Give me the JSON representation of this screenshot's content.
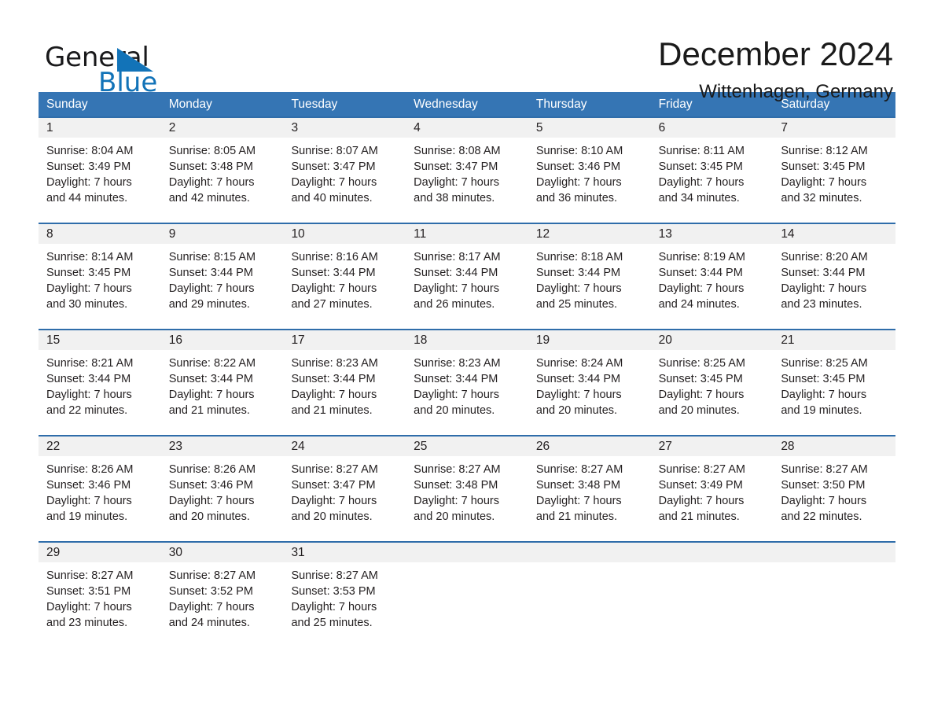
{
  "brand": {
    "name_part1": "General",
    "name_part2": "Blue",
    "accent_color": "#1273b8"
  },
  "header": {
    "title": "December 2024",
    "subtitle": "Wittenhagen, Germany"
  },
  "colors": {
    "header_bar": "#3575b4",
    "row_divider": "#2f6daa",
    "day_band": "#f1f1f1"
  },
  "calendar": {
    "weekdays": [
      "Sunday",
      "Monday",
      "Tuesday",
      "Wednesday",
      "Thursday",
      "Friday",
      "Saturday"
    ],
    "weeks": [
      [
        {
          "day": "1",
          "sunrise": "Sunrise: 8:04 AM",
          "sunset": "Sunset: 3:49 PM",
          "daylight1": "Daylight: 7 hours",
          "daylight2": "and 44 minutes."
        },
        {
          "day": "2",
          "sunrise": "Sunrise: 8:05 AM",
          "sunset": "Sunset: 3:48 PM",
          "daylight1": "Daylight: 7 hours",
          "daylight2": "and 42 minutes."
        },
        {
          "day": "3",
          "sunrise": "Sunrise: 8:07 AM",
          "sunset": "Sunset: 3:47 PM",
          "daylight1": "Daylight: 7 hours",
          "daylight2": "and 40 minutes."
        },
        {
          "day": "4",
          "sunrise": "Sunrise: 8:08 AM",
          "sunset": "Sunset: 3:47 PM",
          "daylight1": "Daylight: 7 hours",
          "daylight2": "and 38 minutes."
        },
        {
          "day": "5",
          "sunrise": "Sunrise: 8:10 AM",
          "sunset": "Sunset: 3:46 PM",
          "daylight1": "Daylight: 7 hours",
          "daylight2": "and 36 minutes."
        },
        {
          "day": "6",
          "sunrise": "Sunrise: 8:11 AM",
          "sunset": "Sunset: 3:45 PM",
          "daylight1": "Daylight: 7 hours",
          "daylight2": "and 34 minutes."
        },
        {
          "day": "7",
          "sunrise": "Sunrise: 8:12 AM",
          "sunset": "Sunset: 3:45 PM",
          "daylight1": "Daylight: 7 hours",
          "daylight2": "and 32 minutes."
        }
      ],
      [
        {
          "day": "8",
          "sunrise": "Sunrise: 8:14 AM",
          "sunset": "Sunset: 3:45 PM",
          "daylight1": "Daylight: 7 hours",
          "daylight2": "and 30 minutes."
        },
        {
          "day": "9",
          "sunrise": "Sunrise: 8:15 AM",
          "sunset": "Sunset: 3:44 PM",
          "daylight1": "Daylight: 7 hours",
          "daylight2": "and 29 minutes."
        },
        {
          "day": "10",
          "sunrise": "Sunrise: 8:16 AM",
          "sunset": "Sunset: 3:44 PM",
          "daylight1": "Daylight: 7 hours",
          "daylight2": "and 27 minutes."
        },
        {
          "day": "11",
          "sunrise": "Sunrise: 8:17 AM",
          "sunset": "Sunset: 3:44 PM",
          "daylight1": "Daylight: 7 hours",
          "daylight2": "and 26 minutes."
        },
        {
          "day": "12",
          "sunrise": "Sunrise: 8:18 AM",
          "sunset": "Sunset: 3:44 PM",
          "daylight1": "Daylight: 7 hours",
          "daylight2": "and 25 minutes."
        },
        {
          "day": "13",
          "sunrise": "Sunrise: 8:19 AM",
          "sunset": "Sunset: 3:44 PM",
          "daylight1": "Daylight: 7 hours",
          "daylight2": "and 24 minutes."
        },
        {
          "day": "14",
          "sunrise": "Sunrise: 8:20 AM",
          "sunset": "Sunset: 3:44 PM",
          "daylight1": "Daylight: 7 hours",
          "daylight2": "and 23 minutes."
        }
      ],
      [
        {
          "day": "15",
          "sunrise": "Sunrise: 8:21 AM",
          "sunset": "Sunset: 3:44 PM",
          "daylight1": "Daylight: 7 hours",
          "daylight2": "and 22 minutes."
        },
        {
          "day": "16",
          "sunrise": "Sunrise: 8:22 AM",
          "sunset": "Sunset: 3:44 PM",
          "daylight1": "Daylight: 7 hours",
          "daylight2": "and 21 minutes."
        },
        {
          "day": "17",
          "sunrise": "Sunrise: 8:23 AM",
          "sunset": "Sunset: 3:44 PM",
          "daylight1": "Daylight: 7 hours",
          "daylight2": "and 21 minutes."
        },
        {
          "day": "18",
          "sunrise": "Sunrise: 8:23 AM",
          "sunset": "Sunset: 3:44 PM",
          "daylight1": "Daylight: 7 hours",
          "daylight2": "and 20 minutes."
        },
        {
          "day": "19",
          "sunrise": "Sunrise: 8:24 AM",
          "sunset": "Sunset: 3:44 PM",
          "daylight1": "Daylight: 7 hours",
          "daylight2": "and 20 minutes."
        },
        {
          "day": "20",
          "sunrise": "Sunrise: 8:25 AM",
          "sunset": "Sunset: 3:45 PM",
          "daylight1": "Daylight: 7 hours",
          "daylight2": "and 20 minutes."
        },
        {
          "day": "21",
          "sunrise": "Sunrise: 8:25 AM",
          "sunset": "Sunset: 3:45 PM",
          "daylight1": "Daylight: 7 hours",
          "daylight2": "and 19 minutes."
        }
      ],
      [
        {
          "day": "22",
          "sunrise": "Sunrise: 8:26 AM",
          "sunset": "Sunset: 3:46 PM",
          "daylight1": "Daylight: 7 hours",
          "daylight2": "and 19 minutes."
        },
        {
          "day": "23",
          "sunrise": "Sunrise: 8:26 AM",
          "sunset": "Sunset: 3:46 PM",
          "daylight1": "Daylight: 7 hours",
          "daylight2": "and 20 minutes."
        },
        {
          "day": "24",
          "sunrise": "Sunrise: 8:27 AM",
          "sunset": "Sunset: 3:47 PM",
          "daylight1": "Daylight: 7 hours",
          "daylight2": "and 20 minutes."
        },
        {
          "day": "25",
          "sunrise": "Sunrise: 8:27 AM",
          "sunset": "Sunset: 3:48 PM",
          "daylight1": "Daylight: 7 hours",
          "daylight2": "and 20 minutes."
        },
        {
          "day": "26",
          "sunrise": "Sunrise: 8:27 AM",
          "sunset": "Sunset: 3:48 PM",
          "daylight1": "Daylight: 7 hours",
          "daylight2": "and 21 minutes."
        },
        {
          "day": "27",
          "sunrise": "Sunrise: 8:27 AM",
          "sunset": "Sunset: 3:49 PM",
          "daylight1": "Daylight: 7 hours",
          "daylight2": "and 21 minutes."
        },
        {
          "day": "28",
          "sunrise": "Sunrise: 8:27 AM",
          "sunset": "Sunset: 3:50 PM",
          "daylight1": "Daylight: 7 hours",
          "daylight2": "and 22 minutes."
        }
      ],
      [
        {
          "day": "29",
          "sunrise": "Sunrise: 8:27 AM",
          "sunset": "Sunset: 3:51 PM",
          "daylight1": "Daylight: 7 hours",
          "daylight2": "and 23 minutes."
        },
        {
          "day": "30",
          "sunrise": "Sunrise: 8:27 AM",
          "sunset": "Sunset: 3:52 PM",
          "daylight1": "Daylight: 7 hours",
          "daylight2": "and 24 minutes."
        },
        {
          "day": "31",
          "sunrise": "Sunrise: 8:27 AM",
          "sunset": "Sunset: 3:53 PM",
          "daylight1": "Daylight: 7 hours",
          "daylight2": "and 25 minutes."
        },
        {
          "day": "",
          "sunrise": "",
          "sunset": "",
          "daylight1": "",
          "daylight2": ""
        },
        {
          "day": "",
          "sunrise": "",
          "sunset": "",
          "daylight1": "",
          "daylight2": ""
        },
        {
          "day": "",
          "sunrise": "",
          "sunset": "",
          "daylight1": "",
          "daylight2": ""
        },
        {
          "day": "",
          "sunrise": "",
          "sunset": "",
          "daylight1": "",
          "daylight2": ""
        }
      ]
    ]
  }
}
